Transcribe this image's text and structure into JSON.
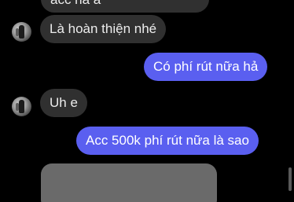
{
  "messages": [
    {
      "direction": "incoming",
      "text": "acc hả à"
    },
    {
      "direction": "incoming",
      "text": "Là hoàn thiện nhé"
    },
    {
      "direction": "outgoing",
      "text": "Có phí rút nữa hả"
    },
    {
      "direction": "incoming",
      "text": "Uh e"
    },
    {
      "direction": "outgoing",
      "text": "Acc 500k phí rút nữa là sao"
    }
  ],
  "colors": {
    "background": "#000000",
    "incoming_bubble": "#303030",
    "outgoing_bubble": "#5a5ff0",
    "media_placeholder": "#6a6a6a"
  },
  "icons": {
    "contact_avatar": "avatar",
    "media_attachment": "image-placeholder"
  }
}
